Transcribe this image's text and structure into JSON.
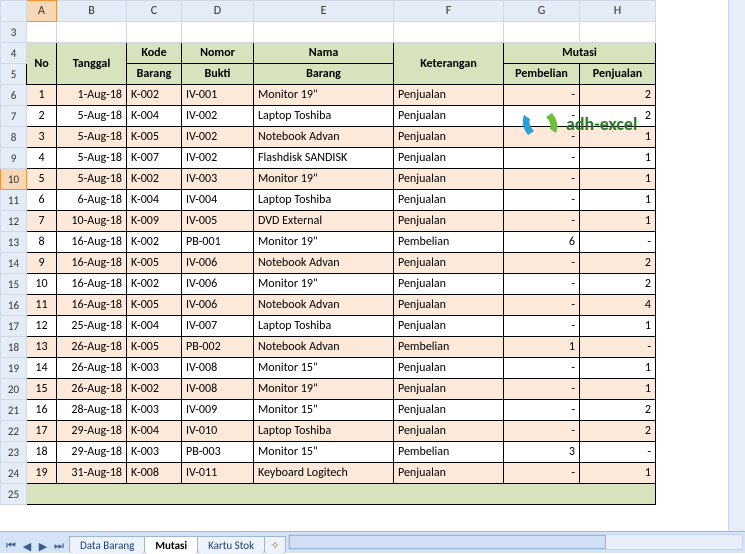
{
  "columns": [
    "A",
    "B",
    "C",
    "D",
    "E",
    "F",
    "G",
    "H"
  ],
  "row_start": 3,
  "row_end": 25,
  "selected_row": 10,
  "headers": {
    "no": "No",
    "tanggal": "Tanggal",
    "kode_barang_1": "Kode",
    "kode_barang_2": "Barang",
    "nomor_bukti_1": "Nomor",
    "nomor_bukti_2": "Bukti",
    "nama_barang_1": "Nama",
    "nama_barang_2": "Barang",
    "keterangan": "Keterangan",
    "mutasi": "Mutasi",
    "pembelian": "Pembelian",
    "penjualan": "Penjualan"
  },
  "rows": [
    {
      "no": 1,
      "tanggal": "1-Aug-18",
      "kode": "K-002",
      "bukti": "IV-001",
      "nama": "Monitor 19\"",
      "ket": "Penjualan",
      "beli": "-",
      "jual": "2"
    },
    {
      "no": 2,
      "tanggal": "5-Aug-18",
      "kode": "K-004",
      "bukti": "IV-002",
      "nama": "Laptop Toshiba",
      "ket": "Penjualan",
      "beli": "-",
      "jual": "2"
    },
    {
      "no": 3,
      "tanggal": "5-Aug-18",
      "kode": "K-005",
      "bukti": "IV-002",
      "nama": "Notebook Advan",
      "ket": "Penjualan",
      "beli": "-",
      "jual": "1"
    },
    {
      "no": 4,
      "tanggal": "5-Aug-18",
      "kode": "K-007",
      "bukti": "IV-002",
      "nama": "Flashdisk SANDISK",
      "ket": "Penjualan",
      "beli": "-",
      "jual": "1"
    },
    {
      "no": 5,
      "tanggal": "5-Aug-18",
      "kode": "K-002",
      "bukti": "IV-003",
      "nama": "Monitor 19\"",
      "ket": "Penjualan",
      "beli": "-",
      "jual": "1"
    },
    {
      "no": 6,
      "tanggal": "6-Aug-18",
      "kode": "K-004",
      "bukti": "IV-004",
      "nama": "Laptop Toshiba",
      "ket": "Penjualan",
      "beli": "-",
      "jual": "1"
    },
    {
      "no": 7,
      "tanggal": "10-Aug-18",
      "kode": "K-009",
      "bukti": "IV-005",
      "nama": "DVD External",
      "ket": "Penjualan",
      "beli": "-",
      "jual": "1"
    },
    {
      "no": 8,
      "tanggal": "16-Aug-18",
      "kode": "K-002",
      "bukti": "PB-001",
      "nama": "Monitor 19\"",
      "ket": "Pembelian",
      "beli": "6",
      "jual": "-"
    },
    {
      "no": 9,
      "tanggal": "16-Aug-18",
      "kode": "K-005",
      "bukti": "IV-006",
      "nama": "Notebook Advan",
      "ket": "Penjualan",
      "beli": "-",
      "jual": "2"
    },
    {
      "no": 10,
      "tanggal": "16-Aug-18",
      "kode": "K-002",
      "bukti": "IV-006",
      "nama": "Monitor 19\"",
      "ket": "Penjualan",
      "beli": "-",
      "jual": "2"
    },
    {
      "no": 11,
      "tanggal": "16-Aug-18",
      "kode": "K-005",
      "bukti": "IV-006",
      "nama": "Notebook Advan",
      "ket": "Penjualan",
      "beli": "-",
      "jual": "4"
    },
    {
      "no": 12,
      "tanggal": "25-Aug-18",
      "kode": "K-004",
      "bukti": "IV-007",
      "nama": "Laptop Toshiba",
      "ket": "Penjualan",
      "beli": "-",
      "jual": "1"
    },
    {
      "no": 13,
      "tanggal": "26-Aug-18",
      "kode": "K-005",
      "bukti": "PB-002",
      "nama": "Notebook Advan",
      "ket": "Pembelian",
      "beli": "1",
      "jual": "-"
    },
    {
      "no": 14,
      "tanggal": "26-Aug-18",
      "kode": "K-003",
      "bukti": "IV-008",
      "nama": "Monitor 15\"",
      "ket": "Penjualan",
      "beli": "-",
      "jual": "1"
    },
    {
      "no": 15,
      "tanggal": "26-Aug-18",
      "kode": "K-002",
      "bukti": "IV-008",
      "nama": "Monitor 19\"",
      "ket": "Penjualan",
      "beli": "-",
      "jual": "1"
    },
    {
      "no": 16,
      "tanggal": "28-Aug-18",
      "kode": "K-003",
      "bukti": "IV-009",
      "nama": "Monitor 15\"",
      "ket": "Penjualan",
      "beli": "-",
      "jual": "2"
    },
    {
      "no": 17,
      "tanggal": "29-Aug-18",
      "kode": "K-004",
      "bukti": "IV-010",
      "nama": "Laptop Toshiba",
      "ket": "Penjualan",
      "beli": "-",
      "jual": "2"
    },
    {
      "no": 18,
      "tanggal": "29-Aug-18",
      "kode": "K-003",
      "bukti": "PB-003",
      "nama": "Monitor 15\"",
      "ket": "Pembelian",
      "beli": "3",
      "jual": "-"
    },
    {
      "no": 19,
      "tanggal": "31-Aug-18",
      "kode": "K-008",
      "bukti": "IV-011",
      "nama": "Keyboard Logitech",
      "ket": "Penjualan",
      "beli": "-",
      "jual": "1"
    }
  ],
  "logo_text": "adh-excel",
  "tabs": {
    "nav_first": "⏮",
    "nav_prev": "◀",
    "nav_next": "▶",
    "nav_last": "⏭",
    "data_barang": "Data Barang",
    "mutasi": "Mutasi",
    "kartu_stok": "Kartu Stok",
    "new": "✧"
  }
}
